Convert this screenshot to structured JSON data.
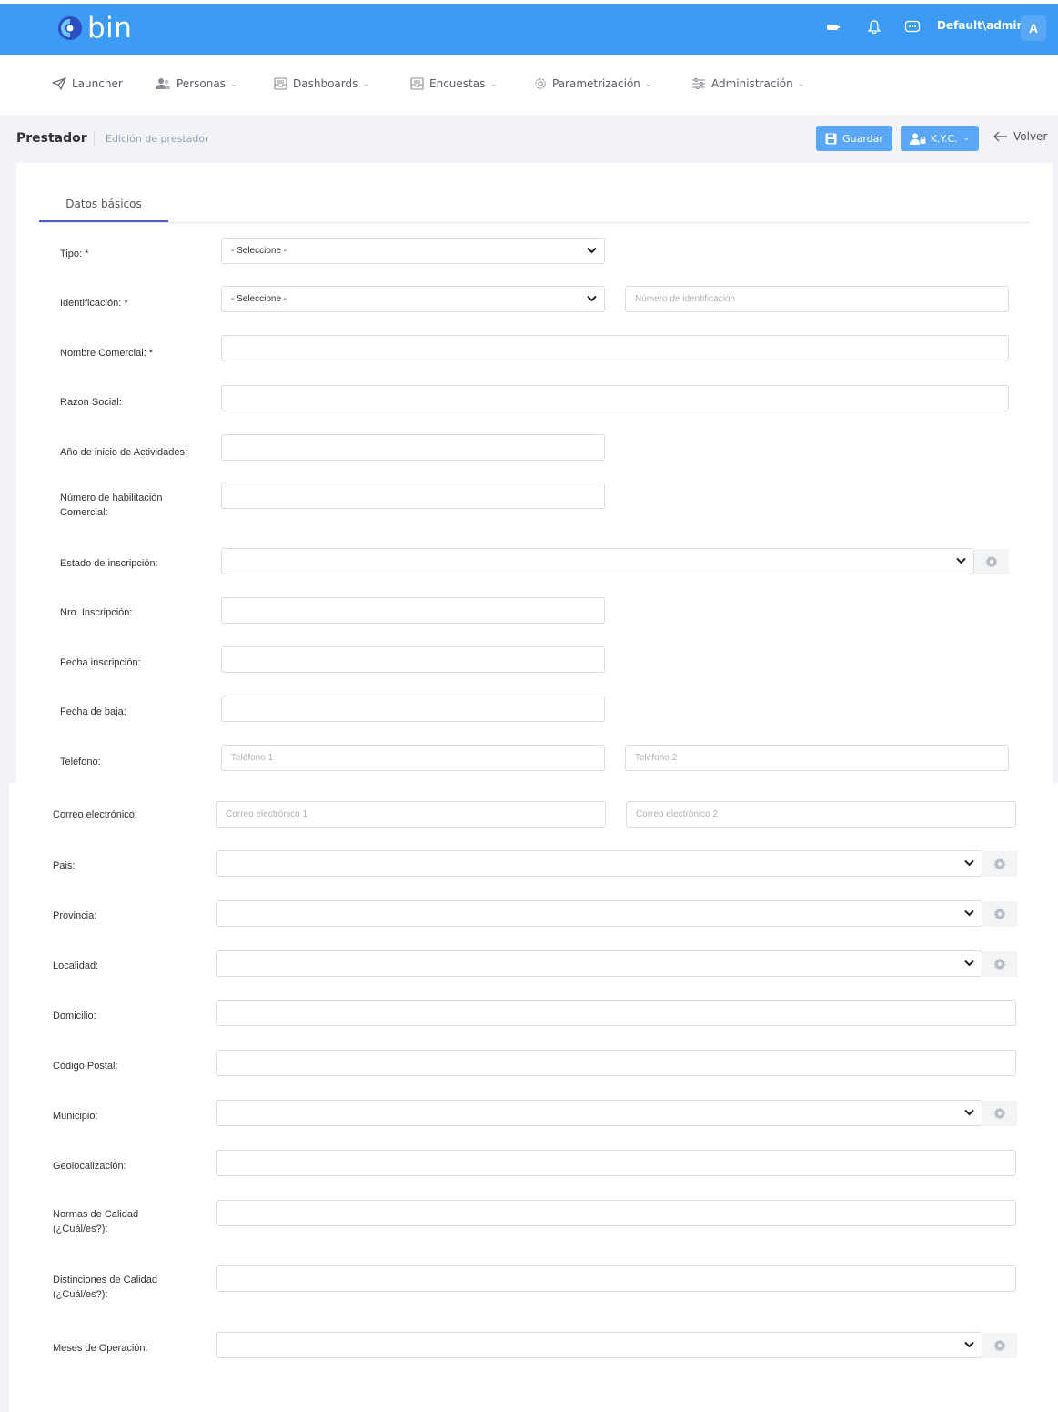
{
  "topbar": {
    "logo_text": "bin",
    "user": "Default\\admin",
    "avatar_initial": "A"
  },
  "nav": [
    {
      "label": "Launcher",
      "icon": "paper-plane-icon"
    },
    {
      "label": "Personas",
      "icon": "users-icon"
    },
    {
      "label": "Dashboards",
      "icon": "inbox-icon"
    },
    {
      "label": "Encuestas",
      "icon": "inbox-icon"
    },
    {
      "label": "Parametrización",
      "icon": "gear-icon"
    },
    {
      "label": "Administración",
      "icon": "sliders-icon"
    }
  ],
  "page": {
    "title": "Prestador",
    "subtitle": "Edición de prestador",
    "save_label": "Guardar",
    "kyc_label": "K.Y.C.",
    "back_label": "Volver"
  },
  "tabs": [
    {
      "label": "Datos básicos"
    }
  ],
  "form": {
    "tipo": {
      "label": "Tipo: *",
      "value": "- Seleccione -"
    },
    "identificacion": {
      "label": "Identificación: *",
      "value": "- Seleccione -",
      "placeholder": "Número de identificación"
    },
    "nombre_comercial": {
      "label": "Nombre Comercial: *"
    },
    "razon_social": {
      "label": "Razon Social:"
    },
    "anio_inicio": {
      "label": "Año de inicio de Actividades:"
    },
    "habilitacion": {
      "label_line1": "Número de habilitación",
      "label_line2": "Comercial:"
    },
    "estado_inscripcion": {
      "label": "Estado de inscripción:"
    },
    "nro_inscripcion": {
      "label": "Nro. Inscripción:"
    },
    "fecha_inscripcion": {
      "label": "Fecha inscripción:"
    },
    "fecha_baja": {
      "label": "Fecha de baja:"
    },
    "telefono": {
      "label": "Teléfono:",
      "placeholder1": "Teléfono 1",
      "placeholder2": "Teléfono 2"
    },
    "correo": {
      "label": "Correo electrónico:",
      "placeholder1": "Correo electrónico 1",
      "placeholder2": "Correo electrónico 2"
    },
    "pais": {
      "label": "Pais:"
    },
    "provincia": {
      "label": "Provincia:"
    },
    "localidad": {
      "label": "Localidad:"
    },
    "domicilio": {
      "label": "Domicilio:"
    },
    "codigo_postal": {
      "label": "Código Postal:"
    },
    "municipio": {
      "label": "Municipio:"
    },
    "geolocalizacion": {
      "label": "Geolocalización:"
    },
    "normas": {
      "label_line1": "Normas de Calidad",
      "label_line2": "(¿Cuál/es?):"
    },
    "distinciones": {
      "label_line1": "Distinciones de Calidad",
      "label_line2": "(¿Cuál/es?):"
    },
    "meses_operacion": {
      "label": "Meses de Operación:"
    }
  },
  "colors": {
    "brand": "#3d9bf3",
    "button": "#5aa8f5",
    "tab_accent": "#4b60c8"
  }
}
